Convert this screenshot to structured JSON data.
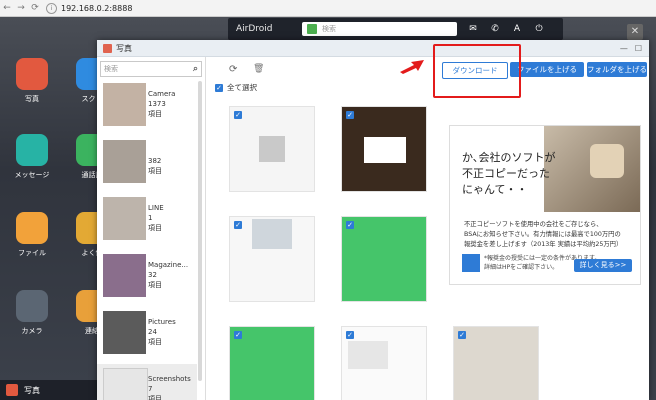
{
  "browser": {
    "url": "192.168.0.2:8888"
  },
  "topbar": {
    "logo": "AirDroid",
    "search_placeholder": "検索"
  },
  "apps": [
    {
      "label": "写真",
      "color": "#e2593f"
    },
    {
      "label": "スクリ",
      "color": "#2f8be0"
    },
    {
      "label": "メッセージ",
      "color": "#27b3a5"
    },
    {
      "label": "通話記",
      "color": "#3bb35f"
    },
    {
      "label": "ファイル",
      "color": "#f2a23a"
    },
    {
      "label": "よく使",
      "color": "#e3a934"
    },
    {
      "label": "カメラ",
      "color": "#5b6673"
    },
    {
      "label": "連絡",
      "color": "#e8a03a"
    }
  ],
  "taskbar": {
    "label": "写真"
  },
  "window": {
    "title": "写真",
    "search_placeholder": "検索",
    "select_all": "全て選択",
    "buttons": {
      "download": "ダウンロード",
      "upload_file": "ファイルを上げる",
      "upload_folder": "フォルダを上げる"
    },
    "albums": [
      {
        "name": "Camera",
        "count": "1373",
        "unit": "項目"
      },
      {
        "name": "",
        "count": "382",
        "unit": "項目"
      },
      {
        "name": "LINE",
        "count": "1",
        "unit": "項目"
      },
      {
        "name": "Magazine...",
        "count": "32",
        "unit": "項目"
      },
      {
        "name": "Pictures",
        "count": "24",
        "unit": "項目"
      },
      {
        "name": "Screenshots",
        "count": "7",
        "unit": "項目"
      }
    ]
  },
  "ad": {
    "headline1": "か､会社のソフトが",
    "headline2": "不正コピーだった",
    "headline3": "にゃんて・・",
    "body1": "不正コピーソフトを使用中の会社をご存じなら、",
    "body2": "BSAにお知らせ下さい。有力情報には最高で100万円の",
    "body3": "報奨金を差し上げます（2013年 実績は平均約25万円）",
    "note1": "*報奨金の授受には一定の条件があります。",
    "note2": "詳細はHPをご確認下さい。",
    "cta": "詳しく見る>>"
  }
}
